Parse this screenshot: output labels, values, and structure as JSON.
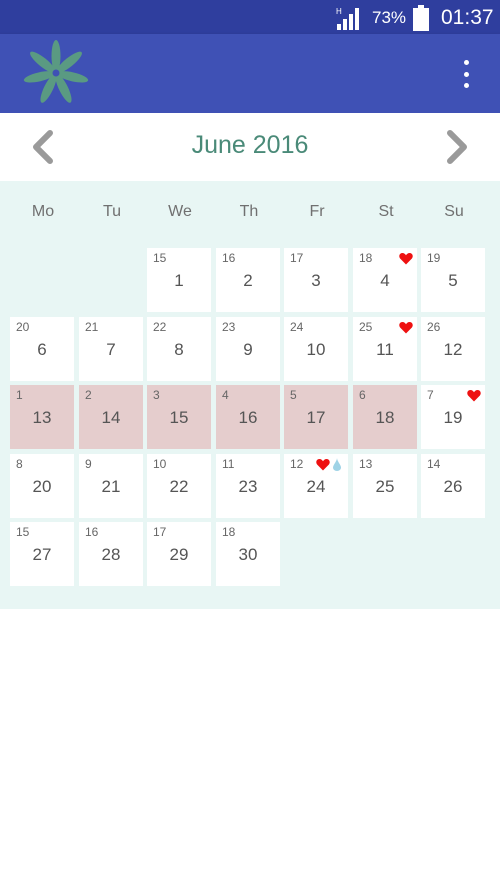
{
  "status_bar": {
    "network": "H",
    "battery_percent": "73%",
    "time": "01:37"
  },
  "app_bar": {
    "logo_icon": "flower-logo-icon",
    "menu_icon": "more-vert-icon"
  },
  "month_header": {
    "title": "June 2016",
    "prev_icon": "chevron-left-icon",
    "next_icon": "chevron-right-icon"
  },
  "colors": {
    "status_bar": "#2f3e9e",
    "app_bar": "#3f51b5",
    "calendar_bg": "#e8f6f4",
    "period_cell": "#e5cdcd",
    "heart": "#ee1111",
    "title": "#4a8a78"
  },
  "weekdays": [
    "Mo",
    "Tu",
    "We",
    "Th",
    "Fr",
    "St",
    "Su"
  ],
  "weeks": [
    [
      null,
      null,
      {
        "cycle": "15",
        "date": "1"
      },
      {
        "cycle": "16",
        "date": "2"
      },
      {
        "cycle": "17",
        "date": "3"
      },
      {
        "cycle": "18",
        "date": "4",
        "heart": true
      },
      {
        "cycle": "19",
        "date": "5"
      }
    ],
    [
      {
        "cycle": "20",
        "date": "6"
      },
      {
        "cycle": "21",
        "date": "7"
      },
      {
        "cycle": "22",
        "date": "8"
      },
      {
        "cycle": "23",
        "date": "9"
      },
      {
        "cycle": "24",
        "date": "10"
      },
      {
        "cycle": "25",
        "date": "11",
        "heart": true
      },
      {
        "cycle": "26",
        "date": "12"
      }
    ],
    [
      {
        "cycle": "1",
        "date": "13",
        "period": true
      },
      {
        "cycle": "2",
        "date": "14",
        "period": true
      },
      {
        "cycle": "3",
        "date": "15",
        "period": true
      },
      {
        "cycle": "4",
        "date": "16",
        "period": true
      },
      {
        "cycle": "5",
        "date": "17",
        "period": true
      },
      {
        "cycle": "6",
        "date": "18",
        "period": true
      },
      {
        "cycle": "7",
        "date": "19",
        "heart": true
      }
    ],
    [
      {
        "cycle": "8",
        "date": "20"
      },
      {
        "cycle": "9",
        "date": "21"
      },
      {
        "cycle": "10",
        "date": "22"
      },
      {
        "cycle": "11",
        "date": "23"
      },
      {
        "cycle": "12",
        "date": "24",
        "heart": true,
        "drop": true
      },
      {
        "cycle": "13",
        "date": "25"
      },
      {
        "cycle": "14",
        "date": "26"
      }
    ],
    [
      {
        "cycle": "15",
        "date": "27"
      },
      {
        "cycle": "16",
        "date": "28"
      },
      {
        "cycle": "17",
        "date": "29"
      },
      {
        "cycle": "18",
        "date": "30"
      },
      null,
      null,
      null
    ]
  ]
}
